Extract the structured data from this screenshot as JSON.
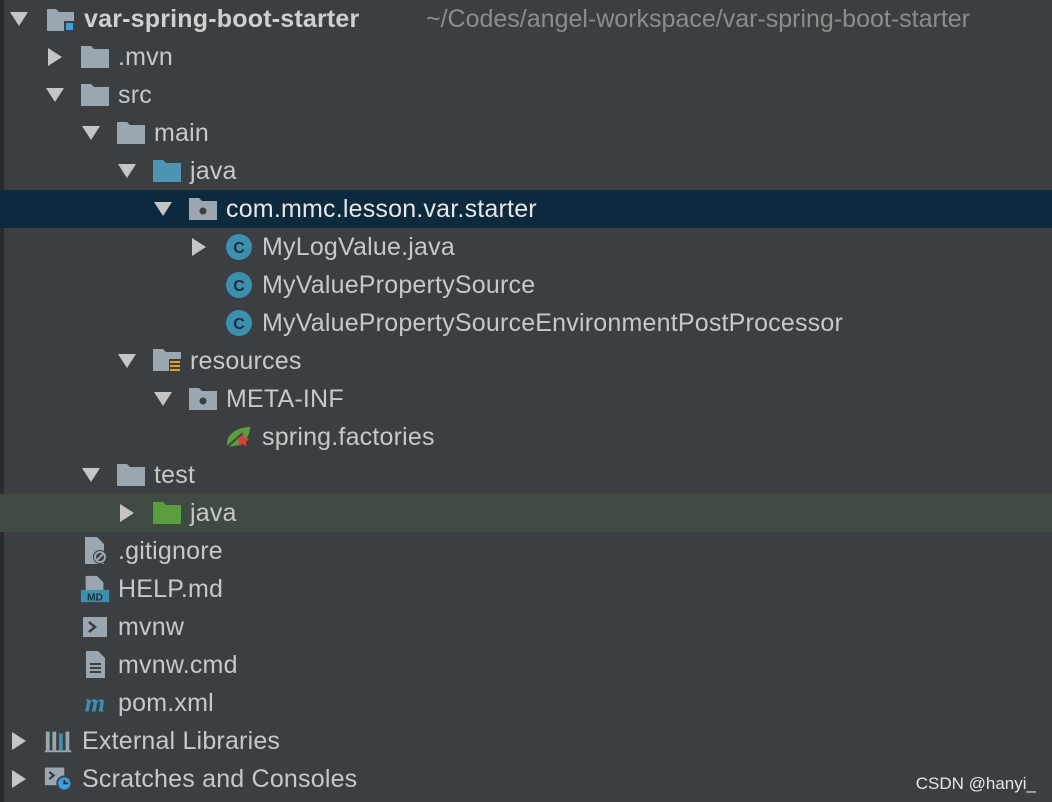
{
  "project": {
    "name": "var-spring-boot-starter",
    "path": "~/Codes/angel-workspace/var-spring-boot-starter"
  },
  "tree": {
    "mvn": ".mvn",
    "src": "src",
    "main": "main",
    "java": "java",
    "package": "com.mmc.lesson.var.starter",
    "class1": "MyLogValue.java",
    "class2": "MyValuePropertySource",
    "class3": "MyValuePropertySourceEnvironmentPostProcessor",
    "resources": "resources",
    "metainf": "META-INF",
    "factories": "spring.factories",
    "test": "test",
    "test_java": "java",
    "gitignore": ".gitignore",
    "help": "HELP.md",
    "mvnw": "mvnw",
    "mvnwcmd": "mvnw.cmd",
    "pom": "pom.xml",
    "external": "External Libraries",
    "scratches": "Scratches and Consoles"
  },
  "watermark": "CSDN @hanyi_",
  "colors": {
    "background": "#3c3f41",
    "selection": "#0d293e",
    "test_highlight": "#3f4b40",
    "folder": "#9aa7b0",
    "source_folder": "#4e94b4",
    "test_folder": "#5c9e3f",
    "class_icon": "#3d8fb0"
  }
}
